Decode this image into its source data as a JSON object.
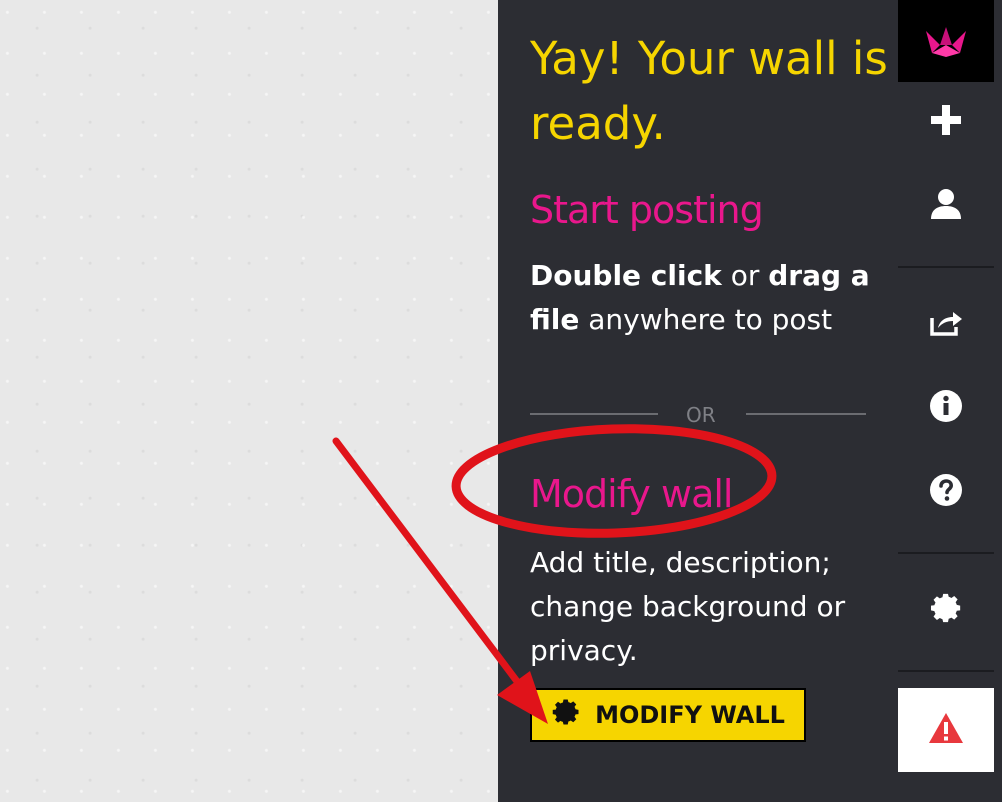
{
  "panel": {
    "title": "Yay! Your wall is ready.",
    "posting_heading": "Start posting",
    "posting_bold1": "Double click",
    "posting_or": " or ",
    "posting_bold2": "drag a file",
    "posting_rest": " anywhere to post",
    "or_label": "OR",
    "modify_heading": "Modify wall",
    "modify_desc": "Add title, description; change background or privacy.",
    "modify_button": "MODIFY WALL"
  },
  "rail": {
    "icons": [
      "crane-logo-icon",
      "plus-icon",
      "user-icon",
      "share-icon",
      "info-icon",
      "help-icon",
      "gear-icon",
      "alert-icon"
    ]
  },
  "colors": {
    "accent_yellow": "#f6d500",
    "accent_pink": "#e9178c",
    "panel_bg": "#2c2d33",
    "annotation_red": "#e0131a"
  }
}
